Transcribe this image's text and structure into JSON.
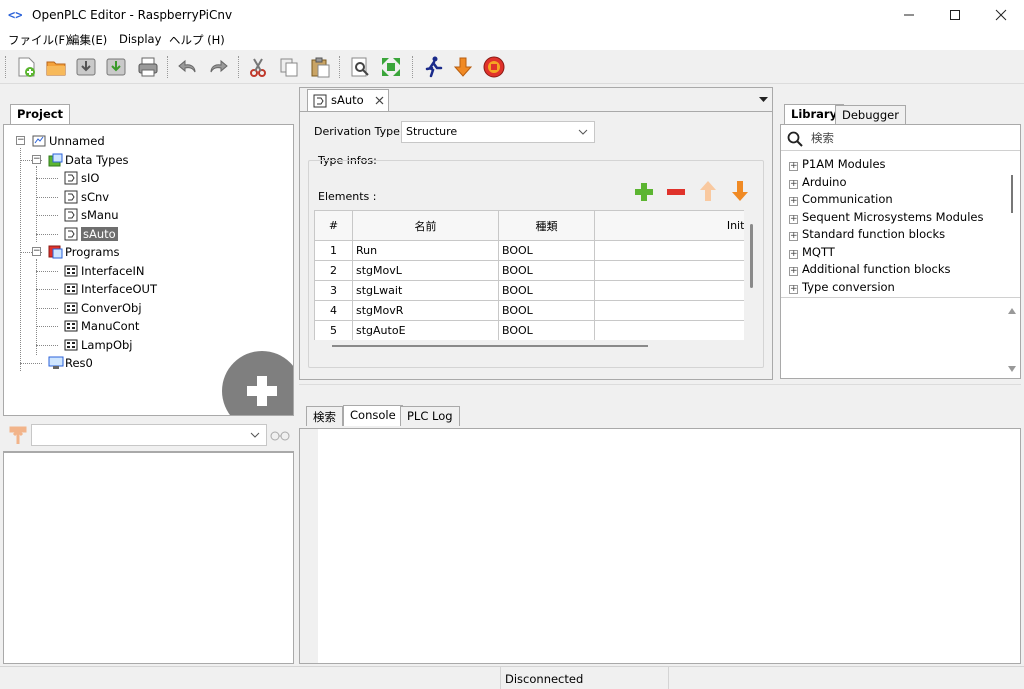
{
  "window": {
    "title": "OpenPLC Editor - RaspberryPiCnv",
    "icon": "code-brackets-icon"
  },
  "menu": [
    "ファイル(F)",
    "編集(E)",
    "Display",
    "ヘルプ (H)"
  ],
  "toolbar": {
    "icons": [
      "new-file-icon",
      "open-folder-icon",
      "save-icon",
      "save-as-icon",
      "print-icon",
      "undo-icon",
      "redo-icon",
      "cut-icon",
      "copy-icon",
      "paste-icon",
      "find-icon",
      "fullscreen-icon",
      "run-icon",
      "download-icon",
      "stop-icon"
    ]
  },
  "project": {
    "tab": "Project",
    "tree": [
      {
        "label": "Unnamed",
        "level": 0,
        "icon": "project-icon"
      },
      {
        "label": "Data Types",
        "level": 1,
        "icon": "datatypes-icon"
      },
      {
        "label": "sIO",
        "level": 2,
        "icon": "datatype-icon"
      },
      {
        "label": "sCnv",
        "level": 2,
        "icon": "datatype-icon"
      },
      {
        "label": "sManu",
        "level": 2,
        "icon": "datatype-icon"
      },
      {
        "label": "sAuto",
        "level": 2,
        "icon": "datatype-icon",
        "selected": true
      },
      {
        "label": "Programs",
        "level": 1,
        "icon": "programs-icon"
      },
      {
        "label": "InterfaceIN",
        "level": 2,
        "icon": "program-icon"
      },
      {
        "label": "InterfaceOUT",
        "level": 2,
        "icon": "program-icon"
      },
      {
        "label": "ConverObj",
        "level": 2,
        "icon": "program-icon"
      },
      {
        "label": "ManuCont",
        "level": 2,
        "icon": "program-icon"
      },
      {
        "label": "LampObj",
        "level": 2,
        "icon": "program-icon"
      },
      {
        "label": "Res0",
        "level": 1,
        "icon": "resource-icon"
      }
    ]
  },
  "editor": {
    "tab": "sAuto",
    "derivation_label": "Derivation Type:",
    "derivation_value": "Structure",
    "type_infos_label": "Type infos:",
    "elements_label": "Elements :",
    "columns": [
      "#",
      "名前",
      "種類",
      "Initial Value"
    ],
    "rows": [
      {
        "n": "1",
        "name": "Run",
        "type": "BOOL",
        "init": ""
      },
      {
        "n": "2",
        "name": "stgMovL",
        "type": "BOOL",
        "init": ""
      },
      {
        "n": "3",
        "name": "stgLwait",
        "type": "BOOL",
        "init": ""
      },
      {
        "n": "4",
        "name": "stgMovR",
        "type": "BOOL",
        "init": ""
      },
      {
        "n": "5",
        "name": "stgAutoE",
        "type": "BOOL",
        "init": ""
      }
    ]
  },
  "library": {
    "tabs": [
      "Library",
      "Debugger"
    ],
    "search_placeholder": "検索",
    "items": [
      "P1AM Modules",
      "Arduino",
      "Communication",
      "Sequent Microsystems Modules",
      "Standard function blocks",
      "MQTT",
      "Additional function blocks",
      "Type conversion"
    ]
  },
  "bottom": {
    "tabs": [
      "検索",
      "Console",
      "PLC Log"
    ]
  },
  "status": {
    "text": "Disconnected"
  },
  "colors": {
    "accent_blue": "#2b62d9",
    "selection_gray": "#6e6e6e",
    "add_green": "#5cb531",
    "remove_red": "#e0322b",
    "move_orange": "#f08a24"
  }
}
